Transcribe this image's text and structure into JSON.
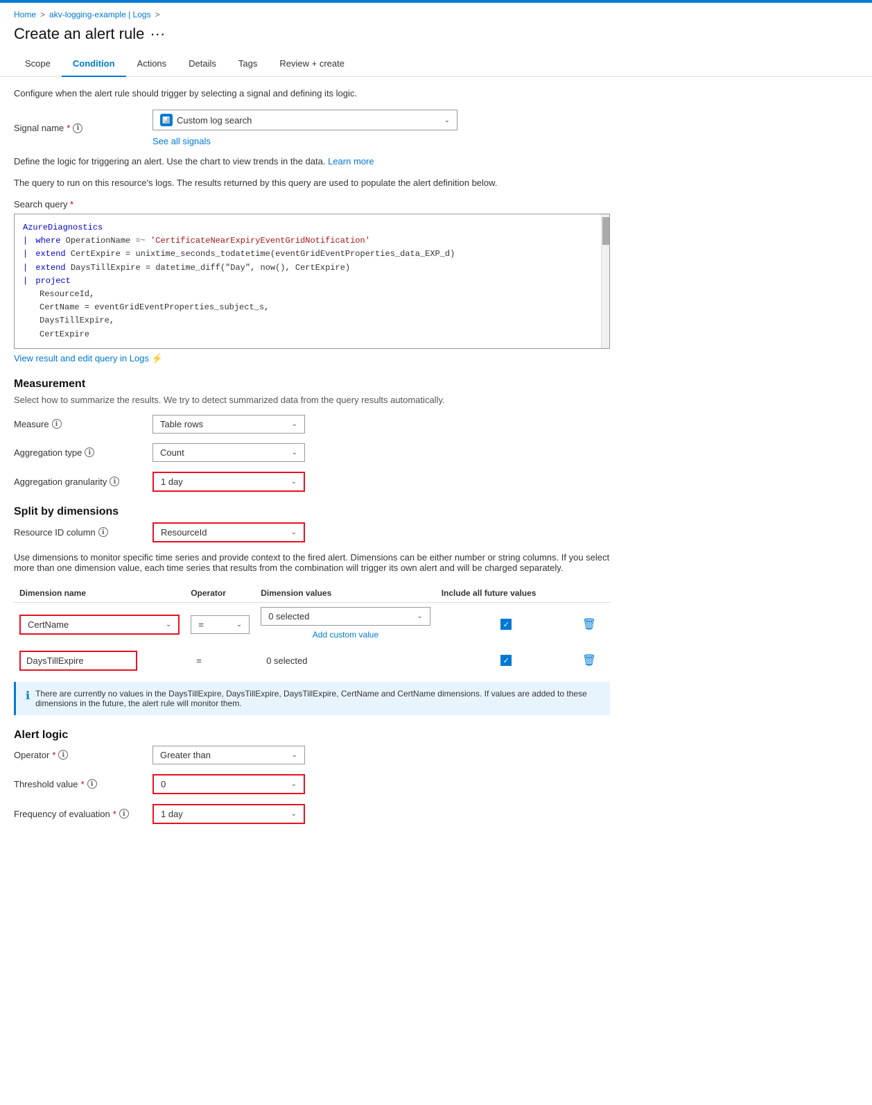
{
  "topbar": {
    "color": "#0078d4"
  },
  "breadcrumb": {
    "items": [
      "Home",
      "akv-logging-example | Logs"
    ],
    "separators": [
      ">",
      ">"
    ]
  },
  "page": {
    "title": "Create an alert rule",
    "more_label": "···"
  },
  "tabs": [
    {
      "label": "Scope",
      "active": false
    },
    {
      "label": "Condition",
      "active": true
    },
    {
      "label": "Actions",
      "active": false
    },
    {
      "label": "Details",
      "active": false
    },
    {
      "label": "Tags",
      "active": false
    },
    {
      "label": "Review + create",
      "active": false
    }
  ],
  "condition": {
    "description": "Configure when the alert rule should trigger by selecting a signal and defining its logic.",
    "signal_label": "Signal name",
    "signal_value": "Custom log search",
    "see_all_signals": "See all signals",
    "define_logic_text": "Define the logic for triggering an alert. Use the chart to view trends in the data.",
    "learn_more": "Learn more",
    "query_resource_text": "The query to run on this resource's logs. The results returned by this query are used to populate the alert definition below.",
    "search_query_label": "Search query",
    "query_lines": [
      {
        "indent": 0,
        "type": "keyword",
        "content": "AzureDiagnostics"
      },
      {
        "indent": 1,
        "pipe": "|",
        "type": "mixed",
        "parts": [
          {
            "type": "kw",
            "text": "where "
          },
          {
            "type": "text",
            "text": "OperationName "
          },
          {
            "type": "op",
            "text": "=~ "
          },
          {
            "type": "string",
            "text": "'CertificateNearExpiryEventGridNotification'"
          }
        ]
      },
      {
        "indent": 1,
        "pipe": "|",
        "type": "mixed",
        "parts": [
          {
            "type": "kw",
            "text": "extend "
          },
          {
            "type": "text",
            "text": "CertExpire = unixtime_seconds_todatetime(eventGridEventProperties_data_EXP_d)"
          }
        ]
      },
      {
        "indent": 1,
        "pipe": "|",
        "type": "mixed",
        "parts": [
          {
            "type": "kw",
            "text": "extend "
          },
          {
            "type": "text",
            "text": "DaysTillExpire = datetime_diff(\"Day\", now(), CertExpire)"
          }
        ]
      },
      {
        "indent": 1,
        "pipe": "|",
        "type": "mixed",
        "parts": [
          {
            "type": "kw",
            "text": "project"
          }
        ]
      },
      {
        "indent": 2,
        "type": "text",
        "parts": [
          {
            "type": "text",
            "text": "ResourceId,"
          }
        ]
      },
      {
        "indent": 2,
        "type": "text",
        "parts": [
          {
            "type": "text",
            "text": "CertName = eventGridEventProperties_subject_s,"
          }
        ]
      },
      {
        "indent": 2,
        "type": "text",
        "parts": [
          {
            "type": "text",
            "text": "DaysTillExpire,"
          }
        ]
      },
      {
        "indent": 2,
        "type": "text",
        "parts": [
          {
            "type": "text",
            "text": "CertExpire"
          }
        ]
      }
    ],
    "view_logs_link": "View result and edit query in Logs"
  },
  "measurement": {
    "title": "Measurement",
    "subtitle": "Select how to summarize the results. We try to detect summarized data from the query results automatically.",
    "measure_label": "Measure",
    "measure_value": "Table rows",
    "aggregation_type_label": "Aggregation type",
    "aggregation_type_value": "Count",
    "aggregation_granularity_label": "Aggregation granularity",
    "aggregation_granularity_value": "1 day"
  },
  "split": {
    "title": "Split by dimensions",
    "resource_id_label": "Resource ID column",
    "resource_id_value": "ResourceId",
    "info_text": "Use dimensions to monitor specific time series and provide context to the fired alert. Dimensions can be either number or string columns. If you select more than one dimension value, each time series that results from the combination will trigger its own alert and will be charged separately.",
    "table_headers": [
      "Dimension name",
      "Operator",
      "Dimension values",
      "Include all future values"
    ],
    "rows": [
      {
        "name": "CertName",
        "operator": "=",
        "values": "0 selected",
        "include_all": true,
        "name_is_select": true
      },
      {
        "name": "DaysTillExpire",
        "operator": "=",
        "values": "0 selected",
        "include_all": true,
        "name_is_select": false
      }
    ],
    "add_custom": "Add custom value",
    "info_box_text": "There are currently no values in the DaysTillExpire, DaysTillExpire, DaysTillExpire, CertName and CertName dimensions. If values are added to these dimensions in the future, the alert rule will monitor them."
  },
  "alert_logic": {
    "title": "Alert logic",
    "operator_label": "Operator",
    "operator_value": "Greater than",
    "threshold_label": "Threshold value",
    "threshold_value": "0",
    "frequency_label": "Frequency of evaluation",
    "frequency_value": "1 day"
  },
  "icons": {
    "info": "ℹ",
    "chevron_down": "∨",
    "trash": "🗑",
    "check": "✓",
    "signal": "📊",
    "logs_icon": "🔗"
  }
}
